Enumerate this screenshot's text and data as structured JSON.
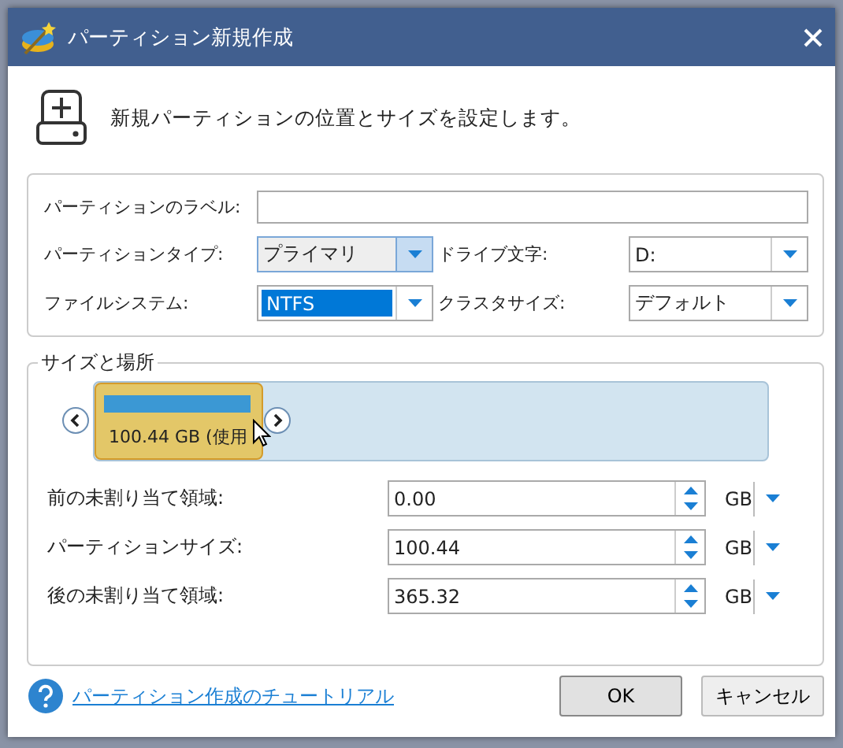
{
  "window": {
    "title": "パーティション新規作成"
  },
  "header": {
    "text": "新規パーティションの位置とサイズを設定します。"
  },
  "properties": {
    "label_field": {
      "label": "パーティションのラベル:"
    },
    "selects": [
      {
        "label": "パーティションタイプ:",
        "value": "プライマリ",
        "hovered": true,
        "value_selected": false
      },
      {
        "label": "ドライブ文字:",
        "value": "D:",
        "hovered": false,
        "value_selected": false
      },
      {
        "label": "ファイルシステム:",
        "value": "NTFS",
        "hovered": false,
        "value_selected": true
      },
      {
        "label": "クラスタサイズ:",
        "value": "デフォルト",
        "hovered": false,
        "value_selected": false
      }
    ]
  },
  "size_location": {
    "title": "サイズと場所",
    "disk_map": {
      "partition_label": "100.44 GB (使用",
      "level": 0.25
    },
    "fields": [
      {
        "label": "前の未割り当て領域:",
        "value": "0.00",
        "unit": "GB"
      },
      {
        "label": "パーティションサイズ:",
        "value": "100.44",
        "unit": "GB"
      },
      {
        "label": "後の未割り当て領域:",
        "value": "365.32",
        "unit": "GB"
      }
    ]
  },
  "footer": {
    "help_link": "パーティション作成のチュートリアル",
    "buttons": [
      {
        "label": "OK",
        "default": true
      },
      {
        "label": "キャンセル",
        "default": false
      }
    ]
  }
}
